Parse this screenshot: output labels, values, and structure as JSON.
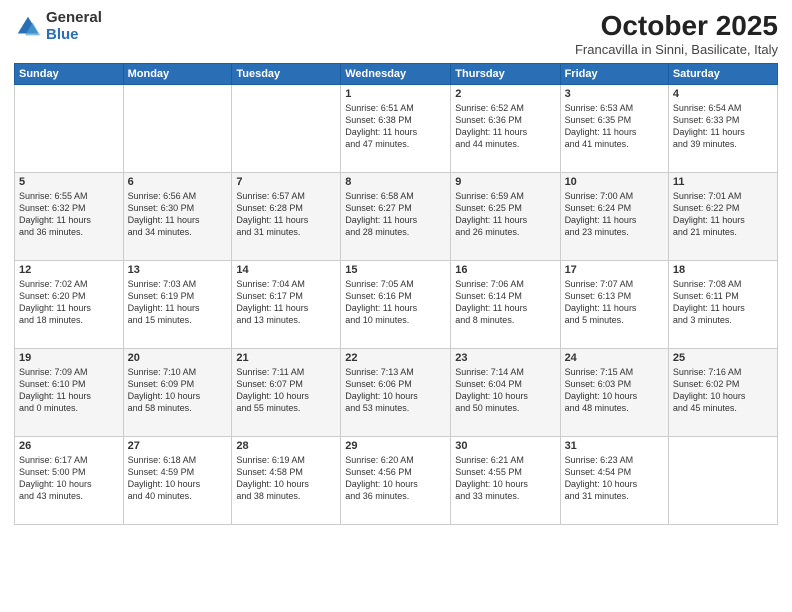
{
  "logo": {
    "general": "General",
    "blue": "Blue"
  },
  "header": {
    "month": "October 2025",
    "location": "Francavilla in Sinni, Basilicate, Italy"
  },
  "days": [
    "Sunday",
    "Monday",
    "Tuesday",
    "Wednesday",
    "Thursday",
    "Friday",
    "Saturday"
  ],
  "weeks": [
    [
      {
        "day": "",
        "content": ""
      },
      {
        "day": "",
        "content": ""
      },
      {
        "day": "",
        "content": ""
      },
      {
        "day": "1",
        "content": "Sunrise: 6:51 AM\nSunset: 6:38 PM\nDaylight: 11 hours\nand 47 minutes."
      },
      {
        "day": "2",
        "content": "Sunrise: 6:52 AM\nSunset: 6:36 PM\nDaylight: 11 hours\nand 44 minutes."
      },
      {
        "day": "3",
        "content": "Sunrise: 6:53 AM\nSunset: 6:35 PM\nDaylight: 11 hours\nand 41 minutes."
      },
      {
        "day": "4",
        "content": "Sunrise: 6:54 AM\nSunset: 6:33 PM\nDaylight: 11 hours\nand 39 minutes."
      }
    ],
    [
      {
        "day": "5",
        "content": "Sunrise: 6:55 AM\nSunset: 6:32 PM\nDaylight: 11 hours\nand 36 minutes."
      },
      {
        "day": "6",
        "content": "Sunrise: 6:56 AM\nSunset: 6:30 PM\nDaylight: 11 hours\nand 34 minutes."
      },
      {
        "day": "7",
        "content": "Sunrise: 6:57 AM\nSunset: 6:28 PM\nDaylight: 11 hours\nand 31 minutes."
      },
      {
        "day": "8",
        "content": "Sunrise: 6:58 AM\nSunset: 6:27 PM\nDaylight: 11 hours\nand 28 minutes."
      },
      {
        "day": "9",
        "content": "Sunrise: 6:59 AM\nSunset: 6:25 PM\nDaylight: 11 hours\nand 26 minutes."
      },
      {
        "day": "10",
        "content": "Sunrise: 7:00 AM\nSunset: 6:24 PM\nDaylight: 11 hours\nand 23 minutes."
      },
      {
        "day": "11",
        "content": "Sunrise: 7:01 AM\nSunset: 6:22 PM\nDaylight: 11 hours\nand 21 minutes."
      }
    ],
    [
      {
        "day": "12",
        "content": "Sunrise: 7:02 AM\nSunset: 6:20 PM\nDaylight: 11 hours\nand 18 minutes."
      },
      {
        "day": "13",
        "content": "Sunrise: 7:03 AM\nSunset: 6:19 PM\nDaylight: 11 hours\nand 15 minutes."
      },
      {
        "day": "14",
        "content": "Sunrise: 7:04 AM\nSunset: 6:17 PM\nDaylight: 11 hours\nand 13 minutes."
      },
      {
        "day": "15",
        "content": "Sunrise: 7:05 AM\nSunset: 6:16 PM\nDaylight: 11 hours\nand 10 minutes."
      },
      {
        "day": "16",
        "content": "Sunrise: 7:06 AM\nSunset: 6:14 PM\nDaylight: 11 hours\nand 8 minutes."
      },
      {
        "day": "17",
        "content": "Sunrise: 7:07 AM\nSunset: 6:13 PM\nDaylight: 11 hours\nand 5 minutes."
      },
      {
        "day": "18",
        "content": "Sunrise: 7:08 AM\nSunset: 6:11 PM\nDaylight: 11 hours\nand 3 minutes."
      }
    ],
    [
      {
        "day": "19",
        "content": "Sunrise: 7:09 AM\nSunset: 6:10 PM\nDaylight: 11 hours\nand 0 minutes."
      },
      {
        "day": "20",
        "content": "Sunrise: 7:10 AM\nSunset: 6:09 PM\nDaylight: 10 hours\nand 58 minutes."
      },
      {
        "day": "21",
        "content": "Sunrise: 7:11 AM\nSunset: 6:07 PM\nDaylight: 10 hours\nand 55 minutes."
      },
      {
        "day": "22",
        "content": "Sunrise: 7:13 AM\nSunset: 6:06 PM\nDaylight: 10 hours\nand 53 minutes."
      },
      {
        "day": "23",
        "content": "Sunrise: 7:14 AM\nSunset: 6:04 PM\nDaylight: 10 hours\nand 50 minutes."
      },
      {
        "day": "24",
        "content": "Sunrise: 7:15 AM\nSunset: 6:03 PM\nDaylight: 10 hours\nand 48 minutes."
      },
      {
        "day": "25",
        "content": "Sunrise: 7:16 AM\nSunset: 6:02 PM\nDaylight: 10 hours\nand 45 minutes."
      }
    ],
    [
      {
        "day": "26",
        "content": "Sunrise: 6:17 AM\nSunset: 5:00 PM\nDaylight: 10 hours\nand 43 minutes."
      },
      {
        "day": "27",
        "content": "Sunrise: 6:18 AM\nSunset: 4:59 PM\nDaylight: 10 hours\nand 40 minutes."
      },
      {
        "day": "28",
        "content": "Sunrise: 6:19 AM\nSunset: 4:58 PM\nDaylight: 10 hours\nand 38 minutes."
      },
      {
        "day": "29",
        "content": "Sunrise: 6:20 AM\nSunset: 4:56 PM\nDaylight: 10 hours\nand 36 minutes."
      },
      {
        "day": "30",
        "content": "Sunrise: 6:21 AM\nSunset: 4:55 PM\nDaylight: 10 hours\nand 33 minutes."
      },
      {
        "day": "31",
        "content": "Sunrise: 6:23 AM\nSunset: 4:54 PM\nDaylight: 10 hours\nand 31 minutes."
      },
      {
        "day": "",
        "content": ""
      }
    ]
  ]
}
